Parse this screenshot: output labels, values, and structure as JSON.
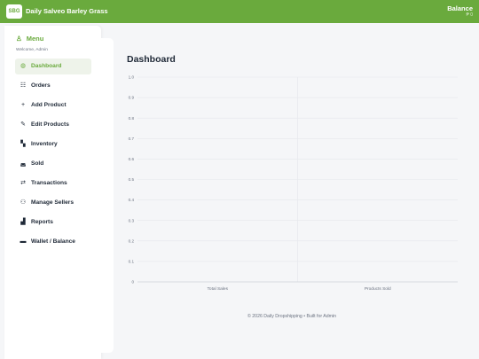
{
  "app": {
    "logo_text": "SBG",
    "title": "Daily Salveo Barley Grass"
  },
  "balance": {
    "label": "Balance",
    "value": "₱ 0"
  },
  "sidebar": {
    "menu_label": "Menu",
    "welcome": "Welcome, Admin",
    "items": [
      {
        "label": "Dashboard",
        "icon": "dashboard-icon",
        "active": true
      },
      {
        "label": "Orders",
        "icon": "list-icon"
      },
      {
        "label": "Add Product",
        "icon": "plus-icon"
      },
      {
        "label": "Edit Products",
        "icon": "edit-icon"
      },
      {
        "label": "Inventory",
        "icon": "boxes-icon"
      },
      {
        "label": "Sold",
        "icon": "basket-icon"
      },
      {
        "label": "Transactions",
        "icon": "exchange-icon"
      },
      {
        "label": "Manage Sellers",
        "icon": "users-icon"
      },
      {
        "label": "Reports",
        "icon": "chart-icon"
      },
      {
        "label": "Wallet / Balance",
        "icon": "wallet-icon"
      }
    ]
  },
  "main": {
    "title": "Dashboard"
  },
  "chart_data": {
    "type": "bar",
    "categories": [
      "Total Sales",
      "Products Sold"
    ],
    "series": [
      {
        "values": [
          0,
          0
        ]
      }
    ],
    "ylim": [
      0,
      1
    ],
    "yticks": [
      "0",
      "0.1",
      "0.2",
      "0.3",
      "0.4",
      "0.5",
      "0.6",
      "0.7",
      "0.8",
      "0.9",
      "1.0"
    ],
    "grid": true,
    "colors": {
      "grid": "#e5e7eb",
      "text": "#6b7280"
    }
  },
  "footer": {
    "text": "© 2026 Daily Dropshipping • Built for Admin"
  }
}
